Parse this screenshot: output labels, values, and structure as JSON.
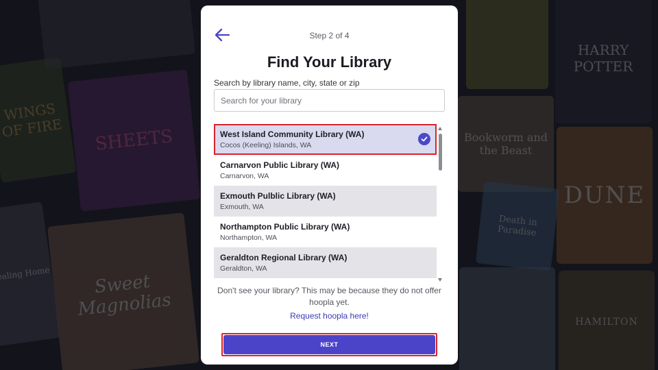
{
  "background": {
    "posters": [
      {
        "title": "WINGS OF FIRE",
        "color": "#3a4a2a"
      },
      {
        "title": "SHEETS",
        "color": "#5a2a6a"
      },
      {
        "title": "Sweet Magnolias",
        "color": "#7a5a4a"
      },
      {
        "title": "Stealing Home",
        "color": "#4a4a5a"
      },
      {
        "title": "HARRY POTTER",
        "color": "#2a2a3a"
      },
      {
        "title": "DUNE",
        "color": "#8a5a2a"
      },
      {
        "title": "Bookworm and the Beast",
        "color": "#6a5a4a"
      },
      {
        "title": "Death in Paradise",
        "color": "#3a5a7a"
      },
      {
        "title": "HAMILTON",
        "color": "#5a4a2a"
      }
    ]
  },
  "modal": {
    "step": "Step 2 of 4",
    "title": "Find Your Library",
    "search_label": "Search by library name, city, state or zip",
    "search_placeholder": "Search for your library",
    "search_value": "",
    "libraries": [
      {
        "name": "West Island Community Library (WA)",
        "location": "Cocos (Keeling) Islands, WA",
        "selected": true
      },
      {
        "name": "Carnarvon Public Library (WA)",
        "location": "Carnarvon, WA",
        "selected": false
      },
      {
        "name": "Exmouth Pulblic Library (WA)",
        "location": "Exmouth, WA",
        "selected": false
      },
      {
        "name": "Northampton Public Library (WA)",
        "location": "Northampton, WA",
        "selected": false
      },
      {
        "name": "Geraldton Regional Library (WA)",
        "location": "Geraldton, WA",
        "selected": false
      }
    ],
    "notice": "Don't see your library? This may be because they do not offer hoopla yet.",
    "request_link": "Request hoopla here!",
    "next_label": "NEXT"
  },
  "colors": {
    "accent": "#4b44c9",
    "highlight": "#d9222a"
  },
  "icons": {
    "back": "arrow-left-icon",
    "check": "check-circle-icon"
  }
}
